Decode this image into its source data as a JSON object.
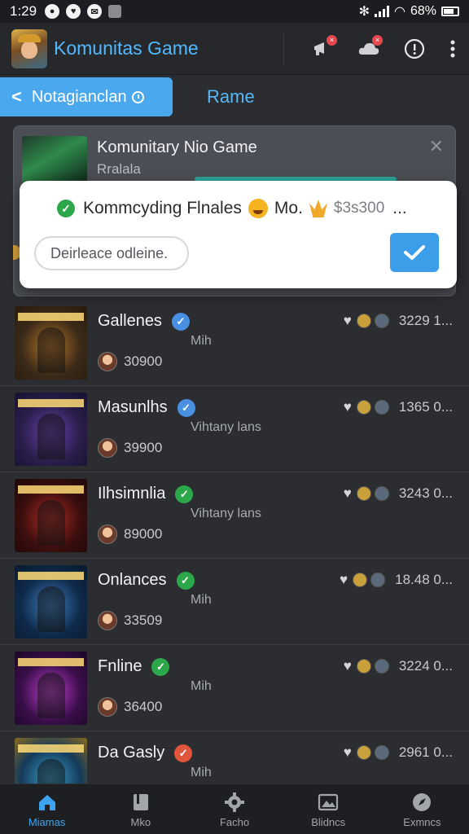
{
  "status_bar": {
    "time": "1:29",
    "battery": "68%"
  },
  "app": {
    "title": "Komunitas Game"
  },
  "tabs": {
    "active": "Notagianclan",
    "second": "Rame"
  },
  "group_card": {
    "title": "Komunitary Nio Game",
    "subtitle": "Rralala"
  },
  "dialog": {
    "message": "Kommcyding Flnales",
    "mid_text": "Mo.",
    "amount": "$3s300",
    "more": "...",
    "input_placeholder": "Deirleace odleine."
  },
  "items": [
    {
      "name": "Gallenes",
      "sub": "Mih",
      "count": "30900",
      "stats": "3229 1...",
      "badge_color": "#4a90e2",
      "thumb": [
        "#3a2a18",
        "#b8742a",
        "#2a1a0e"
      ]
    },
    {
      "name": "Masunlhs",
      "sub": "Vihtany lans",
      "count": "39900",
      "stats": "1365 0...",
      "badge_color": "#4a90e2",
      "thumb": [
        "#2a1e4a",
        "#6a3fb0",
        "#171130"
      ]
    },
    {
      "name": "Ilhsimnlia",
      "sub": "Vihtany lans",
      "count": "89000",
      "stats": "3243 0...",
      "badge_color": "#2ca84a",
      "thumb": [
        "#3a0e0e",
        "#b02a22",
        "#1e0808"
      ]
    },
    {
      "name": "Onlances",
      "sub": "Mih",
      "count": "33509",
      "stats": "18.48 0...",
      "badge_color": "#2ca84a",
      "thumb": [
        "#0e2a4a",
        "#3f7fc0",
        "#0a1a30"
      ]
    },
    {
      "name": "Fnline",
      "sub": "Mih",
      "count": "36400",
      "stats": "3224 0...",
      "badge_color": "#2ca84a",
      "thumb": [
        "#3a0e4a",
        "#c03fd0",
        "#1a0826"
      ]
    },
    {
      "name": "Da Gasly",
      "sub": "Mih",
      "count": "",
      "stats": "2961 0...",
      "badge_color": "#e0553b",
      "thumb": [
        "#143a5a",
        "#3aa0c8",
        "#8a6a20"
      ]
    }
  ],
  "bottom_nav": [
    {
      "label": "Miamas",
      "icon": "home-icon",
      "active": true
    },
    {
      "label": "Mko",
      "icon": "book-icon",
      "active": false
    },
    {
      "label": "Facho",
      "icon": "gear-icon",
      "active": false
    },
    {
      "label": "Blidncs",
      "icon": "image-box-icon",
      "active": false
    },
    {
      "label": "Exmncs",
      "icon": "compass-icon",
      "active": false
    }
  ]
}
